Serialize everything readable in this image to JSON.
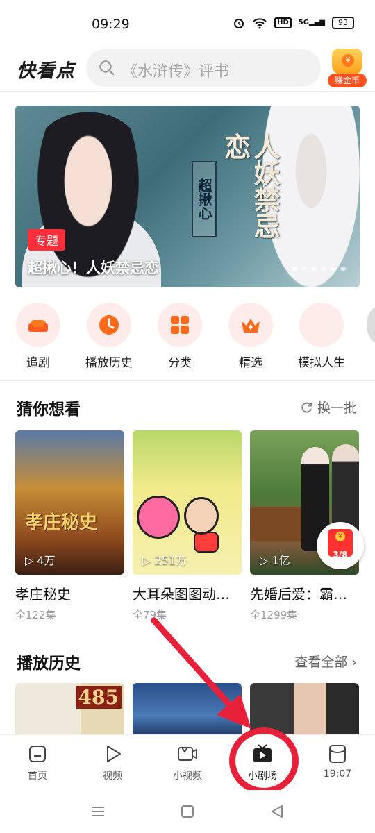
{
  "status_bar": {
    "time": "09:29",
    "network": "5G",
    "hd": "HD",
    "battery": "93"
  },
  "header": {
    "logo": "快看点",
    "search_placeholder": "《水浒传》评书",
    "coin_button_label": "赚金币"
  },
  "banner": {
    "tag": "专题",
    "caption": "超揪心！人妖禁忌恋",
    "art_text_1": "超揪心",
    "art_text_2": "人妖禁忌恋"
  },
  "quick_entries": [
    {
      "label": "追剧",
      "icon": "sofa-icon"
    },
    {
      "label": "播放历史",
      "icon": "clock-icon"
    },
    {
      "label": "分类",
      "icon": "grid-icon"
    },
    {
      "label": "精选",
      "icon": "crown-icon"
    },
    {
      "label": "模拟人生",
      "icon": "avatar-icon"
    }
  ],
  "recommend": {
    "title": "猜你想看",
    "refresh_label": "换一批",
    "items": [
      {
        "name": "孝庄秘史",
        "plays": "4万",
        "episodes": "全122集",
        "art": "孝庄秘史"
      },
      {
        "name": "大耳朵图图动…",
        "plays": "251万",
        "episodes": "全79集"
      },
      {
        "name": "先婚后爱：霸…",
        "plays": "1亿",
        "episodes": "全1299集"
      }
    ]
  },
  "red_packet": {
    "count": "3/8"
  },
  "history": {
    "title": "播放历史",
    "view_all_label": "查看全部",
    "items": [
      {
        "badge": "485"
      },
      {
        "badge": ""
      },
      {
        "badge": ""
      }
    ]
  },
  "bottom_nav": {
    "items": [
      {
        "label": "首页",
        "icon": "home-icon"
      },
      {
        "label": "视频",
        "icon": "play-icon"
      },
      {
        "label": "小视频",
        "icon": "camera-icon"
      },
      {
        "label": "小剧场",
        "icon": "tv-icon"
      },
      {
        "label": "19:07",
        "icon": "task-icon"
      }
    ]
  },
  "colors": {
    "accent": "#ff5a1f",
    "tag_red": "#ff2e3b",
    "highlight_circle": "#e8213a"
  }
}
